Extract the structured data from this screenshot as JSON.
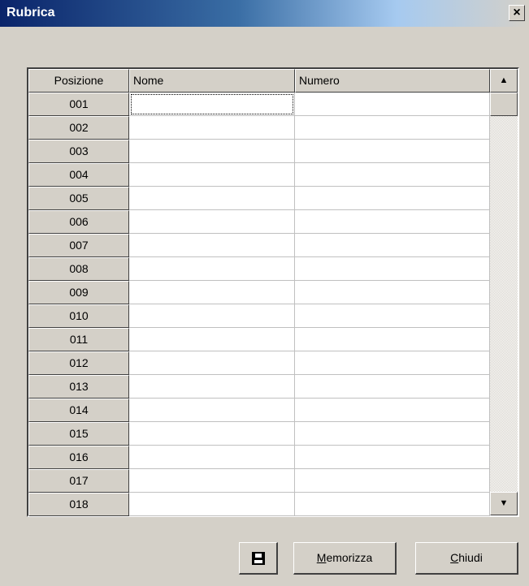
{
  "window": {
    "title": "Rubrica",
    "close_glyph": "×"
  },
  "table": {
    "columns": [
      "Posizione",
      "Nome",
      "Numero"
    ],
    "rows": [
      {
        "posizione": "001",
        "nome": "",
        "numero": ""
      },
      {
        "posizione": "002",
        "nome": "",
        "numero": ""
      },
      {
        "posizione": "003",
        "nome": "",
        "numero": ""
      },
      {
        "posizione": "004",
        "nome": "",
        "numero": ""
      },
      {
        "posizione": "005",
        "nome": "",
        "numero": ""
      },
      {
        "posizione": "006",
        "nome": "",
        "numero": ""
      },
      {
        "posizione": "007",
        "nome": "",
        "numero": ""
      },
      {
        "posizione": "008",
        "nome": "",
        "numero": ""
      },
      {
        "posizione": "009",
        "nome": "",
        "numero": ""
      },
      {
        "posizione": "010",
        "nome": "",
        "numero": ""
      },
      {
        "posizione": "011",
        "nome": "",
        "numero": ""
      },
      {
        "posizione": "012",
        "nome": "",
        "numero": ""
      },
      {
        "posizione": "013",
        "nome": "",
        "numero": ""
      },
      {
        "posizione": "014",
        "nome": "",
        "numero": ""
      },
      {
        "posizione": "015",
        "nome": "",
        "numero": ""
      },
      {
        "posizione": "016",
        "nome": "",
        "numero": ""
      },
      {
        "posizione": "017",
        "nome": "",
        "numero": ""
      },
      {
        "posizione": "018",
        "nome": "",
        "numero": ""
      }
    ],
    "focused_cell": "nome-0"
  },
  "scrollbar": {
    "up_glyph": "▲",
    "down_glyph": "▼"
  },
  "buttons": {
    "save_icon": "floppy-disk-icon",
    "memorizza_first": "M",
    "memorizza_rest": "emorizza",
    "chiudi_first": "C",
    "chiudi_rest": "hiudi"
  }
}
